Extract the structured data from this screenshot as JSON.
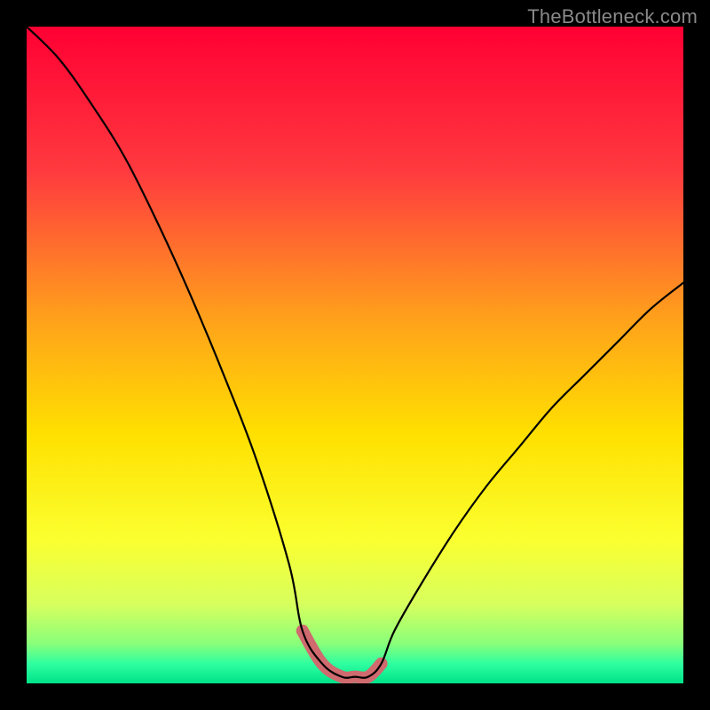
{
  "watermark": "TheBottleneck.com",
  "chart_data": {
    "type": "line",
    "title": "",
    "xlabel": "",
    "ylabel": "",
    "xlim": [
      0,
      100
    ],
    "ylim": [
      0,
      100
    ],
    "grid": false,
    "legend": false,
    "bottleneck_range": [
      42,
      54
    ],
    "series": [
      {
        "name": "bottleneck-curve",
        "x": [
          0,
          5,
          10,
          15,
          20,
          25,
          30,
          35,
          40,
          42,
          45,
          48,
          50,
          52,
          54,
          56,
          60,
          65,
          70,
          75,
          80,
          85,
          90,
          95,
          100
        ],
        "values": [
          100,
          95,
          88,
          80,
          70,
          59,
          47,
          34,
          18,
          8,
          3,
          1,
          1,
          1,
          3,
          8,
          15,
          23,
          30,
          36,
          42,
          47,
          52,
          57,
          61
        ]
      }
    ],
    "background_gradient": {
      "stops": [
        {
          "pos": 0.0,
          "color": "#ff0033"
        },
        {
          "pos": 0.22,
          "color": "#ff3a3f"
        },
        {
          "pos": 0.45,
          "color": "#ffa31a"
        },
        {
          "pos": 0.62,
          "color": "#ffe000"
        },
        {
          "pos": 0.78,
          "color": "#fbff2f"
        },
        {
          "pos": 0.88,
          "color": "#d7ff5e"
        },
        {
          "pos": 0.94,
          "color": "#88ff7a"
        },
        {
          "pos": 0.97,
          "color": "#2fffa0"
        },
        {
          "pos": 1.0,
          "color": "#00e28a"
        }
      ]
    },
    "highlight": {
      "color": "#cf6a6f",
      "stroke_width": 14
    },
    "curve_style": {
      "color": "#000000",
      "stroke_width": 2.2
    }
  }
}
